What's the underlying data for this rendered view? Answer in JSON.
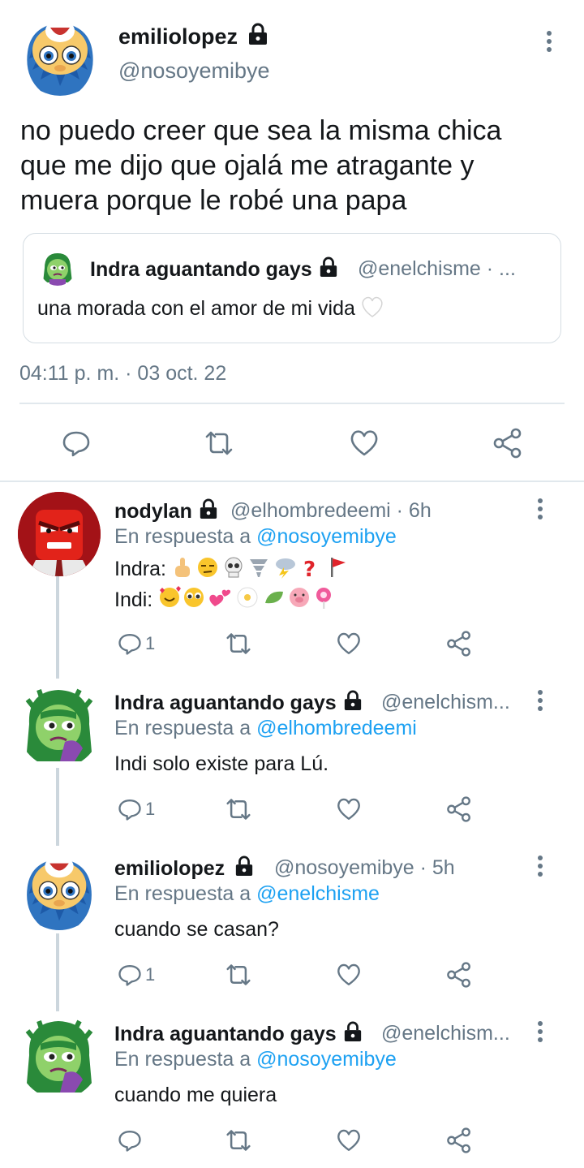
{
  "main_tweet": {
    "name": "emiliolopez",
    "handle": "@nosoyemibye",
    "text_lines": [
      "no puedo creer que sea la misma chica",
      "que me dijo que ojalá me atragante y",
      "muera porque le robé una papa"
    ],
    "quote": {
      "name": "Indra aguantando gays",
      "handle": "@enelchisme · ...",
      "text": "una morada con el amor de mi vida"
    },
    "timestamp": "04:11 p. m. · 03 oct. 22"
  },
  "replies": [
    {
      "name": "nodylan",
      "handle": "@elhombredeemi · 6h",
      "in_reply_prefix": "En respuesta a ",
      "in_reply_to": "@nosoyemibye",
      "lines": [
        "Indra:",
        "Indi:"
      ],
      "reply_count": "1"
    },
    {
      "name": "Indra aguantando gays",
      "handle": "@enelchism...",
      "in_reply_prefix": "En respuesta a ",
      "in_reply_to": "@elhombredeemi",
      "lines": [
        "Indi solo existe para Lú."
      ],
      "reply_count": "1"
    },
    {
      "name": "emiliolopez",
      "handle": "@nosoyemibye · 5h",
      "in_reply_prefix": "En respuesta a ",
      "in_reply_to": "@enelchisme",
      "lines": [
        "cuando se casan?"
      ],
      "reply_count": "1"
    },
    {
      "name": "Indra aguantando gays",
      "handle": "@enelchism...",
      "in_reply_prefix": "En respuesta a ",
      "in_reply_to": "@nosoyemibye",
      "lines": [
        "cuando me quiera"
      ],
      "reply_count": ""
    }
  ],
  "icons": {
    "reply": "reply-icon",
    "retweet": "retweet-icon",
    "like": "heart-icon",
    "share": "share-icon",
    "more": "more-icon",
    "lock": "lock-icon"
  },
  "colors": {
    "text": "#14171a",
    "secondary": "#657786",
    "link": "#1da1f2",
    "divider": "#e1e8ed"
  }
}
